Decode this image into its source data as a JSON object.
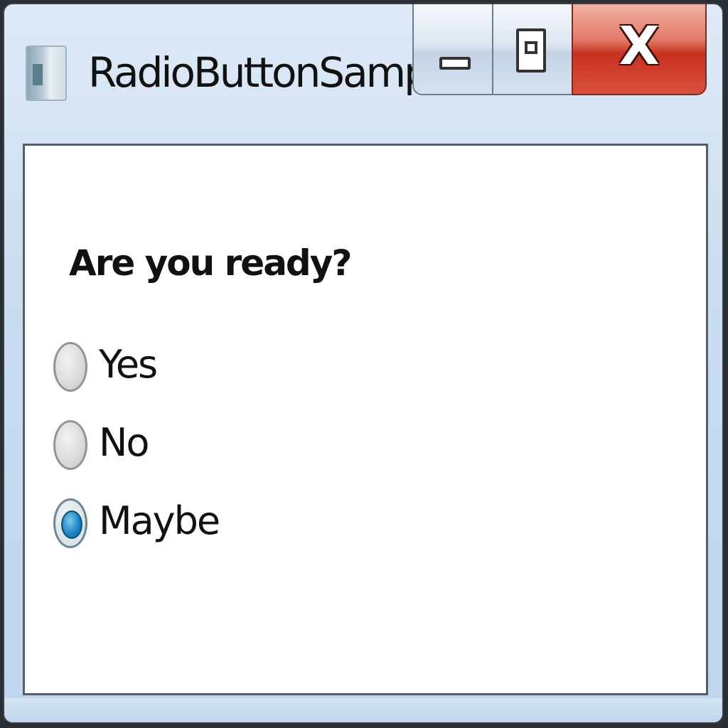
{
  "window": {
    "title": "RadioButtonSample",
    "close_glyph": "X"
  },
  "icons": {
    "app": "app-window-icon",
    "minimize": "minimize-icon",
    "maximize": "maximize-icon",
    "close": "close-icon"
  },
  "form": {
    "question": "Are you ready?",
    "options": [
      {
        "label": "Yes",
        "checked": false
      },
      {
        "label": "No",
        "checked": false
      },
      {
        "label": "Maybe",
        "checked": true
      }
    ]
  },
  "colors": {
    "selected_radio": "#1f86c6",
    "close_button": "#c8321f",
    "titlebar": "#c9dcf0"
  }
}
